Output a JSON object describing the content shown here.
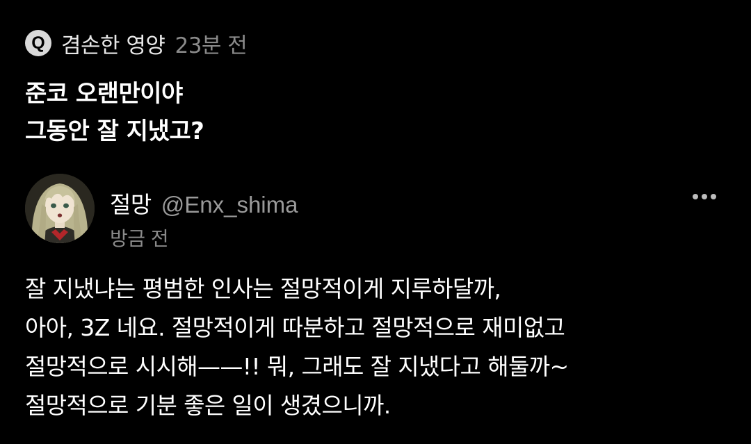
{
  "question": {
    "badge": "Q",
    "author": "겸손한 영양",
    "time": "23분 전",
    "lines": [
      "준코 오랜만이야",
      "그동안 잘 지냈고?"
    ]
  },
  "answer": {
    "name": "절망",
    "handle": "@Enx_shima",
    "time": "방금 전",
    "more_icon": "more-horizontal-icon",
    "lines": [
      "잘 지냈냐는 평범한 인사는 절망적이게 지루하달까,",
      "아아, 3Z 네요. 절망적이게 따분하고 절망적으로 재미없고",
      "절망적으로 시시해——!! 뭐, 그래도 잘 지냈다고 해둘까~",
      "절망적으로 기분 좋은 일이 생겼으니까."
    ]
  },
  "colors": {
    "background": "#000000",
    "primary_text": "#ffffff",
    "secondary_text": "#8a8a8a",
    "badge_bg": "#d9d9d9"
  }
}
